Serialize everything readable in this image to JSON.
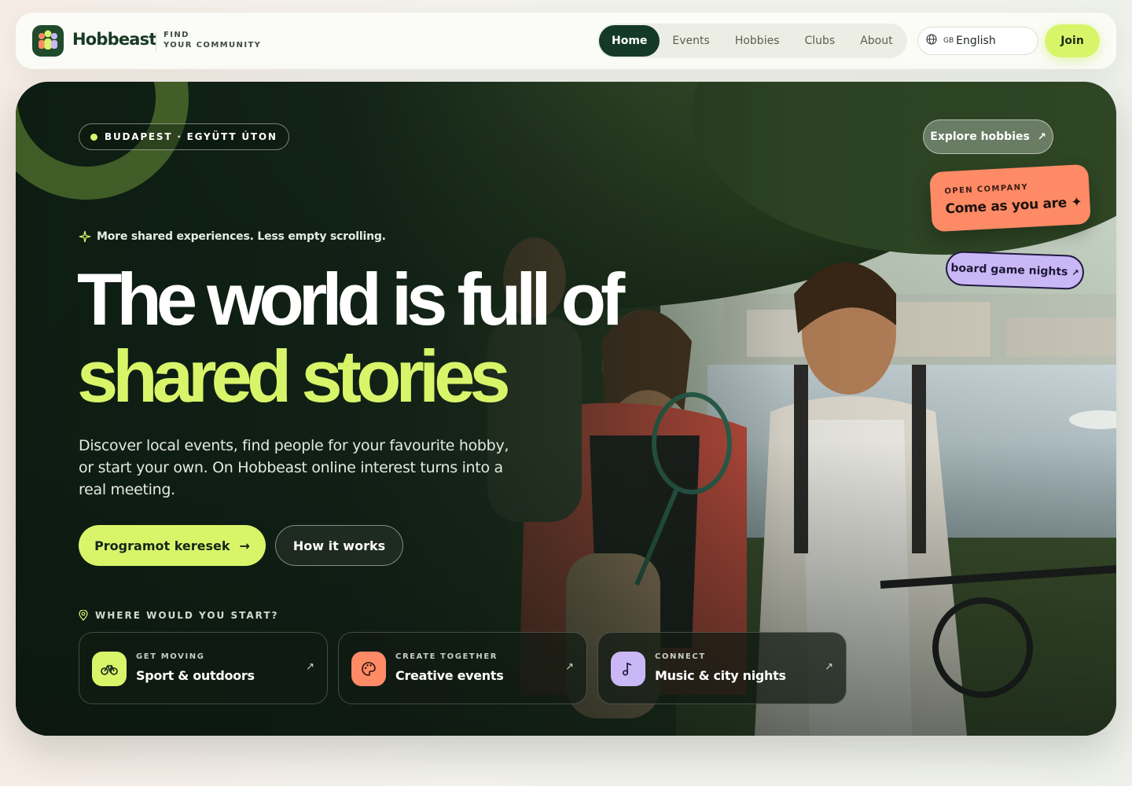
{
  "brand": {
    "name": "Hobbeast",
    "tagline_line1": "FIND",
    "tagline_line2": "YOUR COMMUNITY"
  },
  "nav": {
    "links": [
      {
        "label": "Home",
        "active": true
      },
      {
        "label": "Events",
        "active": false
      },
      {
        "label": "Hobbies",
        "active": false
      },
      {
        "label": "Clubs",
        "active": false
      },
      {
        "label": "About",
        "active": false
      }
    ],
    "language": {
      "flag": "GB",
      "label": "English"
    },
    "join_label": "Join"
  },
  "hero": {
    "location": "BUDAPEST · EGYÜTT ÚTON",
    "tagline": "More shared experiences. Less empty scrolling.",
    "headline_line1": "The world is full of",
    "headline_line2": "shared stories",
    "lead": "Discover local events, find people for your favourite hobby, or start your own. On Hobbeast online interest turns into a real meeting.",
    "primary_cta": "Programot keresek",
    "secondary_cta": "How it works",
    "where_label": "WHERE WOULD YOU START?",
    "explore_label": "Explore hobbies",
    "open_company": {
      "kicker": "OPEN COMPANY",
      "title": "Come as you are ✦"
    },
    "board_chip": "board game nights"
  },
  "cards": [
    {
      "kicker": "GET MOVING",
      "title": "Sport & outdoors",
      "color": "#d8f56a",
      "icon": "bike-icon"
    },
    {
      "kicker": "CREATE TOGETHER",
      "title": "Creative events",
      "color": "#ff8a66",
      "icon": "palette-icon"
    },
    {
      "kicker": "CONNECT",
      "title": "Music & city nights",
      "color": "#c9b8f5",
      "icon": "music-note-icon"
    }
  ],
  "colors": {
    "accent_lime": "#d8f56a",
    "accent_coral": "#ff8a66",
    "accent_lavender": "#c9b8f5",
    "brand_green": "#143a27"
  }
}
